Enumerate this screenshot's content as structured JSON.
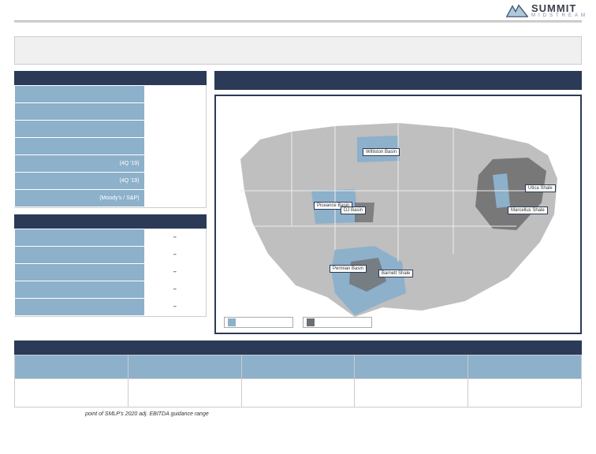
{
  "brand": {
    "name": "SUMMIT",
    "sub": "MIDSTREAM"
  },
  "title": "",
  "panel1": {
    "rows": [
      {
        "label": "",
        "value": ""
      },
      {
        "label": "",
        "value": ""
      },
      {
        "label": "",
        "value": ""
      },
      {
        "label": "",
        "value": ""
      },
      {
        "label": "(4Q '19)",
        "value": ""
      },
      {
        "label": "(4Q '19)",
        "value": ""
      },
      {
        "label": "(Moody's / S&P)",
        "value": ""
      }
    ]
  },
  "panel2": {
    "rows": [
      {
        "label": "",
        "value": "–"
      },
      {
        "label": "",
        "value": "–"
      },
      {
        "label": "",
        "value": "–"
      },
      {
        "label": "",
        "value": "–"
      },
      {
        "label": "",
        "value": "–"
      }
    ]
  },
  "map": {
    "regions": [
      {
        "name": "Williston Basin",
        "style": "left:186px; top:66px;"
      },
      {
        "name": "Piceance Basin",
        "style": "left:124px; top:134px;"
      },
      {
        "name": "DJ Basin",
        "style": "left:158px; top:140px;"
      },
      {
        "name": "Utica Shale",
        "style": "left:392px; top:112px;"
      },
      {
        "name": "Marcellus Shale",
        "style": "left:370px; top:140px;"
      },
      {
        "name": "Permian Basin",
        "style": "left:144px; top:214px;"
      },
      {
        "name": "Barnett Shale",
        "style": "left:206px; top:220px;"
      }
    ],
    "legend": [
      {
        "label": "",
        "color": "#8db0cb"
      },
      {
        "label": "",
        "color": "#6b6f76"
      }
    ]
  },
  "bottom_table": {
    "columns": [
      "",
      "",
      "",
      "",
      ""
    ],
    "row": [
      "",
      "",
      "",
      "",
      ""
    ]
  },
  "footnote": "point of SMLP's 2020 adj. EBITDA guidance range"
}
